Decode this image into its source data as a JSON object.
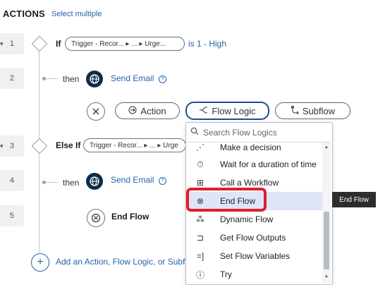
{
  "header": {
    "title": "ACTIONS",
    "select_multiple": "Select multiple"
  },
  "steps": [
    {
      "num": "1",
      "keyword": "If",
      "pill": "Trigger - Recor...  ▸ ... ▸ Urge...",
      "condition": "is 1 - High"
    },
    {
      "num": "2",
      "then": "then",
      "action": "Send Email"
    },
    {
      "num": "3",
      "keyword": "Else If",
      "pill": "Trigger - Recor...  ▸ ... ▸ Urge"
    },
    {
      "num": "4",
      "then": "then",
      "action": "Send Email"
    },
    {
      "num": "5",
      "action": "End Flow"
    }
  ],
  "toolbar": {
    "action_label": "Action",
    "flow_logic_label": "Flow Logic",
    "subflow_label": "Subflow"
  },
  "dropdown": {
    "search_placeholder": "Search Flow Logics",
    "items": [
      {
        "label": "Make a decision",
        "icon": "decision-icon"
      },
      {
        "label": "Wait for a duration of time",
        "icon": "timer-icon"
      },
      {
        "label": "Call a Workflow",
        "icon": "workflow-icon"
      },
      {
        "label": "End Flow",
        "icon": "end-flow-icon"
      },
      {
        "label": "Dynamic Flow",
        "icon": "dynamic-flow-icon"
      },
      {
        "label": "Get Flow Outputs",
        "icon": "outputs-icon"
      },
      {
        "label": "Set Flow Variables",
        "icon": "variables-icon"
      },
      {
        "label": "Try",
        "icon": "try-icon"
      }
    ]
  },
  "tooltip": "End Flow",
  "add_link": "Add an Action, Flow Logic, or Subflo"
}
